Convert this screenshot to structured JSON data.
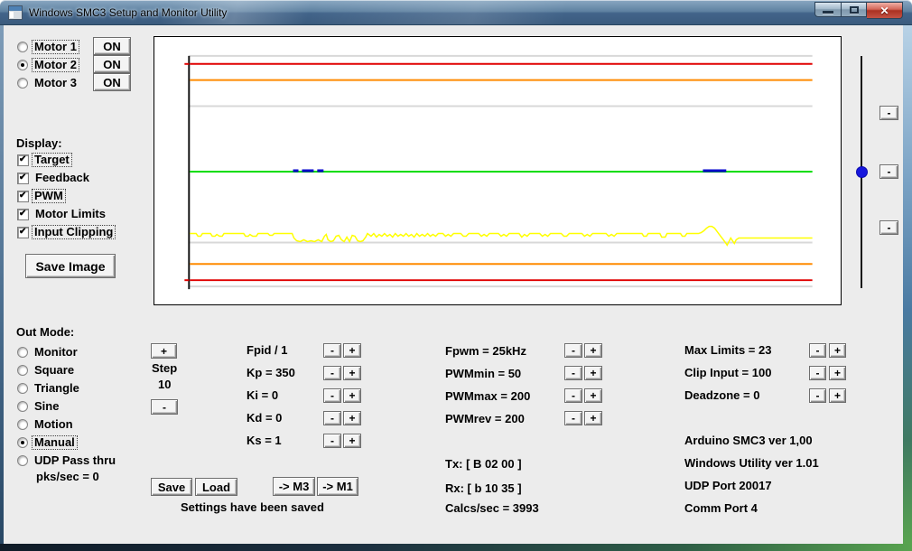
{
  "window": {
    "title": "Windows SMC3 Setup and Monitor Utility",
    "close_glyph": "✕"
  },
  "symbols": {
    "minus": "-",
    "plus": "+"
  },
  "motors": {
    "on_label": "ON",
    "items": [
      {
        "label": "Motor 1",
        "selected": false
      },
      {
        "label": "Motor 2",
        "selected": true
      },
      {
        "label": "Motor 3",
        "selected": false
      }
    ]
  },
  "display": {
    "heading": "Display:",
    "save_image_label": "Save Image",
    "items": [
      {
        "label": "Target",
        "checked": true
      },
      {
        "label": "Feedback",
        "checked": true
      },
      {
        "label": "PWM",
        "checked": true
      },
      {
        "label": "Motor Limits",
        "checked": true
      },
      {
        "label": "Input Clipping",
        "checked": true
      }
    ]
  },
  "out_mode": {
    "heading": "Out Mode:",
    "pks_text": "pks/sec = 0",
    "items": [
      {
        "label": "Monitor",
        "selected": false
      },
      {
        "label": "Square",
        "selected": false
      },
      {
        "label": "Triangle",
        "selected": false
      },
      {
        "label": "Sine",
        "selected": false
      },
      {
        "label": "Motion",
        "selected": false
      },
      {
        "label": "Manual",
        "selected": true
      },
      {
        "label": "UDP Pass thru",
        "selected": false
      }
    ]
  },
  "step": {
    "name": "Step",
    "value": "10"
  },
  "pid": {
    "rows": [
      {
        "label": "Fpid / 1"
      },
      {
        "label": "Kp = 350"
      },
      {
        "label": "Ki = 0"
      },
      {
        "label": "Kd = 0"
      },
      {
        "label": "Ks = 1"
      }
    ]
  },
  "file": {
    "save_label": "Save",
    "load_label": "Load",
    "to_m3_label": "-> M3",
    "to_m1_label": "-> M1",
    "status_text": "Settings have been saved"
  },
  "pwm": {
    "rows": [
      {
        "label": "Fpwm = 25kHz"
      },
      {
        "label": "PWMmin = 50"
      },
      {
        "label": "PWMmax = 200"
      },
      {
        "label": "PWMrev = 200"
      }
    ]
  },
  "comm": {
    "tx": "Tx: [ B 02 00 ]",
    "rx": "Rx: [ b 10 35 ]",
    "calcs": "Calcs/sec = 3993"
  },
  "limits": {
    "rows": [
      {
        "label": "Max Limits = 23"
      },
      {
        "label": "Clip Input = 100"
      },
      {
        "label": "Deadzone = 0"
      }
    ]
  },
  "info": {
    "lines": [
      "Arduino SMC3 ver 1,00",
      "Windows Utility ver 1.01",
      "UDP Port 20017",
      "Comm Port 4"
    ]
  },
  "chart_data": {
    "type": "line",
    "title": "SMC3 motor scope traces",
    "plot": {
      "x0": 207,
      "x1": 902,
      "y_top": 61,
      "y_bottom": 318
    },
    "grid_color": "#d8d8d8",
    "gridlines_y": [
      61,
      117,
      269,
      318
    ],
    "axis": {
      "x": 207,
      "y0": 61,
      "y1": 321,
      "color": "#111111",
      "ticks": [
        {
          "y": 70,
          "color": "#e00000"
        },
        {
          "y": 311,
          "color": "#e00000"
        }
      ]
    },
    "series": [
      {
        "id": "motor-limits",
        "name": "Motor Limits",
        "color": "#e00000",
        "type": "hlines",
        "width": 2,
        "ys": [
          70,
          311
        ]
      },
      {
        "id": "input-clipping",
        "name": "Input Clipping",
        "color": "#ff8a00",
        "type": "hlines",
        "width": 2,
        "ys": [
          88,
          293
        ]
      },
      {
        "id": "target",
        "name": "Target",
        "color": "#00dd00",
        "type": "hlines",
        "width": 2,
        "ys": [
          190
        ]
      },
      {
        "id": "feedback",
        "name": "Feedback",
        "color": "#0000cc",
        "type": "segments",
        "width": 3,
        "y": 189,
        "segments": [
          [
            323,
            329
          ],
          [
            333,
            346
          ],
          [
            350,
            357
          ],
          [
            780,
            806
          ]
        ]
      },
      {
        "id": "pwm",
        "name": "PWM",
        "color": "#ffff00",
        "type": "polyline",
        "width": 1.5,
        "points": [
          [
            208,
            259
          ],
          [
            215,
            259
          ],
          [
            217,
            262
          ],
          [
            220,
            262
          ],
          [
            222,
            259
          ],
          [
            231,
            259
          ],
          [
            233,
            262
          ],
          [
            236,
            262
          ],
          [
            238,
            260
          ],
          [
            241,
            262
          ],
          [
            244,
            262
          ],
          [
            246,
            259
          ],
          [
            268,
            259
          ],
          [
            270,
            262
          ],
          [
            273,
            262
          ],
          [
            275,
            260
          ],
          [
            278,
            262
          ],
          [
            282,
            262
          ],
          [
            284,
            259
          ],
          [
            295,
            259
          ],
          [
            297,
            261
          ],
          [
            300,
            261
          ],
          [
            302,
            259
          ],
          [
            322,
            259
          ],
          [
            324,
            264
          ],
          [
            327,
            267
          ],
          [
            331,
            268
          ],
          [
            335,
            266
          ],
          [
            339,
            268
          ],
          [
            343,
            267
          ],
          [
            347,
            268
          ],
          [
            351,
            266
          ],
          [
            355,
            268
          ],
          [
            358,
            262
          ],
          [
            360,
            260
          ],
          [
            362,
            266
          ],
          [
            365,
            268
          ],
          [
            368,
            267
          ],
          [
            371,
            262
          ],
          [
            374,
            261
          ],
          [
            377,
            266
          ],
          [
            380,
            268
          ],
          [
            383,
            263
          ],
          [
            386,
            268
          ],
          [
            389,
            261
          ],
          [
            392,
            262
          ],
          [
            395,
            267
          ],
          [
            398,
            268
          ],
          [
            401,
            267
          ],
          [
            404,
            263
          ],
          [
            406,
            259
          ],
          [
            410,
            262
          ],
          [
            413,
            259
          ],
          [
            416,
            263
          ],
          [
            419,
            260
          ],
          [
            422,
            262
          ],
          [
            425,
            259
          ],
          [
            428,
            262
          ],
          [
            431,
            260
          ],
          [
            434,
            263
          ],
          [
            437,
            259
          ],
          [
            440,
            262
          ],
          [
            443,
            260
          ],
          [
            446,
            262
          ],
          [
            449,
            259
          ],
          [
            452,
            262
          ],
          [
            455,
            260
          ],
          [
            458,
            263
          ],
          [
            461,
            259
          ],
          [
            464,
            262
          ],
          [
            467,
            260
          ],
          [
            470,
            262
          ],
          [
            473,
            259
          ],
          [
            476,
            262
          ],
          [
            479,
            260
          ],
          [
            482,
            262
          ],
          [
            485,
            259
          ],
          [
            490,
            259
          ],
          [
            493,
            262
          ],
          [
            496,
            260
          ],
          [
            499,
            262
          ],
          [
            502,
            259
          ],
          [
            510,
            259
          ],
          [
            513,
            262
          ],
          [
            516,
            262
          ],
          [
            519,
            259
          ],
          [
            530,
            259
          ],
          [
            533,
            262
          ],
          [
            536,
            260
          ],
          [
            539,
            262
          ],
          [
            542,
            259
          ],
          [
            552,
            259
          ],
          [
            555,
            262
          ],
          [
            558,
            260
          ],
          [
            561,
            262
          ],
          [
            564,
            259
          ],
          [
            575,
            259
          ],
          [
            578,
            263
          ],
          [
            581,
            260
          ],
          [
            584,
            262
          ],
          [
            587,
            259
          ],
          [
            598,
            259
          ],
          [
            601,
            262
          ],
          [
            604,
            260
          ],
          [
            607,
            262
          ],
          [
            610,
            259
          ],
          [
            622,
            259
          ],
          [
            625,
            262
          ],
          [
            628,
            262
          ],
          [
            631,
            259
          ],
          [
            645,
            259
          ],
          [
            648,
            262
          ],
          [
            651,
            260
          ],
          [
            654,
            262
          ],
          [
            657,
            259
          ],
          [
            672,
            259
          ],
          [
            675,
            262
          ],
          [
            678,
            260
          ],
          [
            681,
            262
          ],
          [
            684,
            259
          ],
          [
            700,
            259
          ],
          [
            712,
            259
          ],
          [
            714,
            262
          ],
          [
            717,
            262
          ],
          [
            719,
            259
          ],
          [
            732,
            259
          ],
          [
            734,
            263
          ],
          [
            738,
            263
          ],
          [
            740,
            259
          ],
          [
            755,
            259
          ],
          [
            757,
            262
          ],
          [
            760,
            262
          ],
          [
            762,
            259
          ],
          [
            775,
            259
          ],
          [
            778,
            258
          ],
          [
            781,
            256
          ],
          [
            784,
            253
          ],
          [
            787,
            251
          ],
          [
            790,
            251
          ],
          [
            793,
            253
          ],
          [
            796,
            257
          ],
          [
            799,
            261
          ],
          [
            802,
            265
          ],
          [
            805,
            269
          ],
          [
            807,
            272
          ],
          [
            809,
            268
          ],
          [
            811,
            264
          ],
          [
            813,
            267
          ],
          [
            815,
            270
          ],
          [
            817,
            266
          ],
          [
            820,
            264
          ],
          [
            830,
            264
          ],
          [
            902,
            264
          ]
        ]
      }
    ]
  }
}
